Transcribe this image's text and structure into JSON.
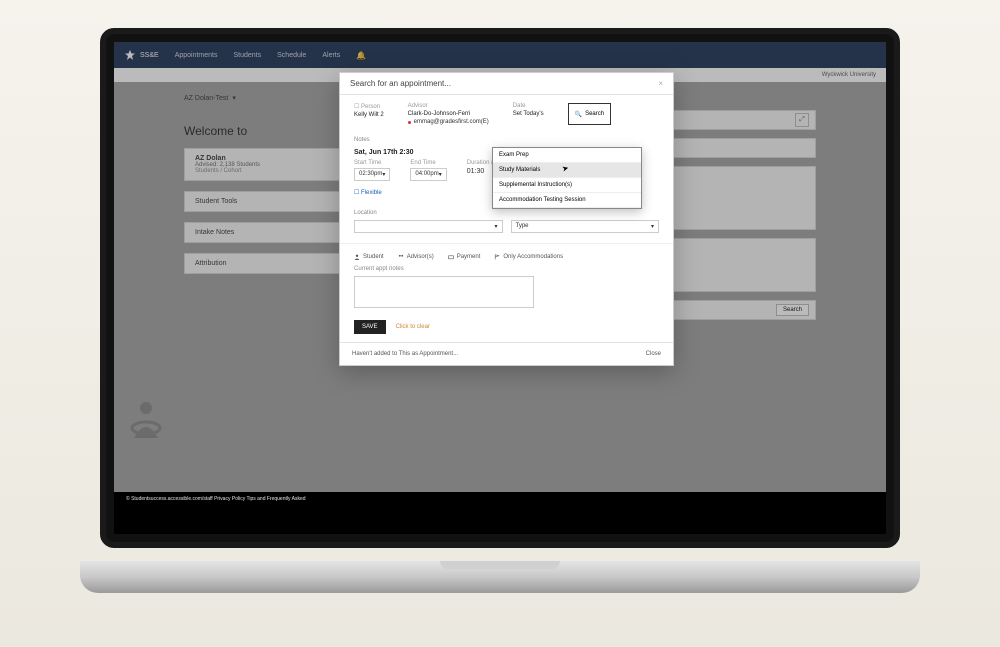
{
  "nav": {
    "brand": "SS&E",
    "items": [
      "Appointments",
      "Students",
      "Schedule",
      "Alerts"
    ],
    "institution": "Wyckwick University"
  },
  "page": {
    "breadcrumb": "AZ Dolan-Test",
    "welcome": "Welcome to",
    "panels": {
      "p1_title": "AZ Dolan",
      "p1_sub1": "Advised: 2,138 Students",
      "p1_sub2": "Students / Cohort",
      "p2_title": "Student Tools",
      "p3_title": "Intake Notes",
      "p4_title": "Attribution"
    },
    "right": {
      "search_btn": "Search"
    }
  },
  "modal": {
    "title": "Search for an appointment...",
    "close": "×",
    "person_label": "Person",
    "person_value": "Kelly Wilt 2",
    "advisor_label": "Advisor",
    "advisor_value": "Clark-Do-Johnson-Ferri",
    "advisor_email": "emmag@gradesfirst.com(E)",
    "date_label": "Date",
    "date_value": "Set Today’s",
    "search_btn": "Search",
    "notes_label": "Notes",
    "date_display": "Sat, Jun 17th 2:30",
    "start_label": "Start Time",
    "start_value": "02:30pm",
    "end_label": "End Time",
    "end_value": "04:00pm",
    "duration_label": "Duration (h:mm)",
    "duration_value": "01:30",
    "view_link": "☐ Flexible",
    "location_label": "Location",
    "location_select": "",
    "type_select": "Type",
    "tabs": {
      "student": "Student",
      "advisors": "Advisor(s)",
      "payment": "Payment",
      "accommodations": "Only Accommodations"
    },
    "textarea_label": "Current appt notes",
    "save_btn": "SAVE",
    "clear_link": "Click to clear",
    "footer_text": "Haven't added to This as Appointment...",
    "footer_close": "Close"
  },
  "dropdown": {
    "options": [
      "Exam Prep",
      "Study Materials",
      "Supplemental Instruction(s)",
      "Accommodation Testing Session"
    ],
    "hover_index": 1
  },
  "footer_tiny": "© Studentsuccess.accessible.com/staff  Privacy Policy  Tips and Frequently Asked"
}
